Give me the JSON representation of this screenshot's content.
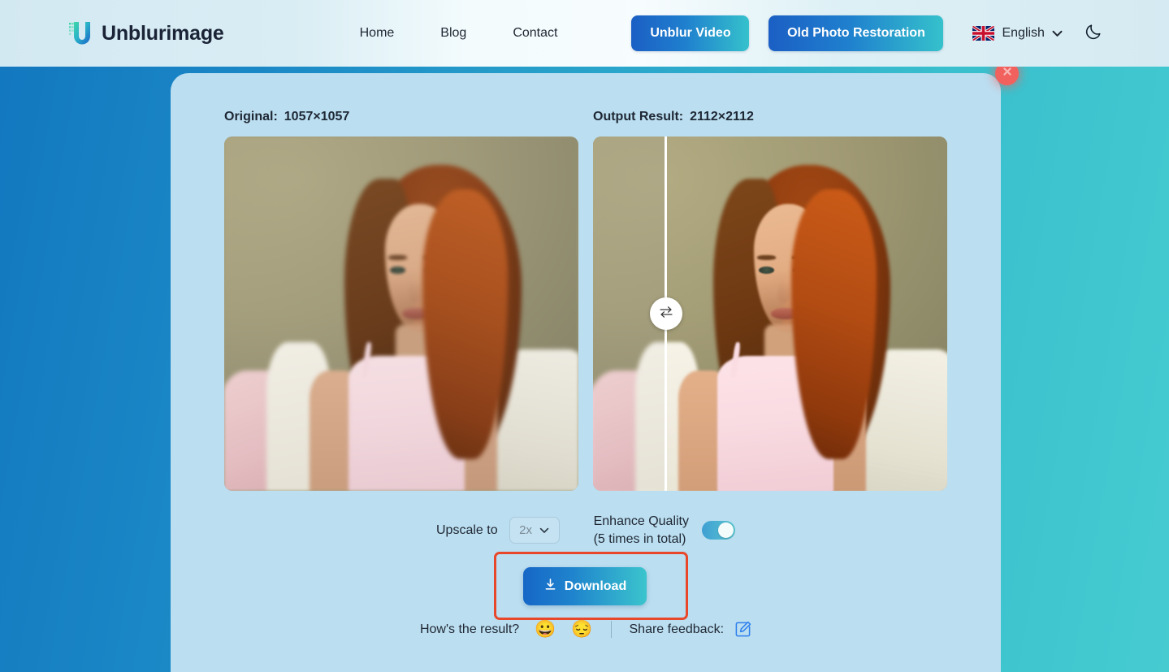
{
  "header": {
    "brand_name": "Unblurimage",
    "logo_icon": "unblurimage-u-logo",
    "nav": [
      {
        "label": "Home",
        "name": "nav-link-home"
      },
      {
        "label": "Blog",
        "name": "nav-link-blog"
      },
      {
        "label": "Contact",
        "name": "nav-link-contact"
      }
    ],
    "cta_unblur_video": "Unblur Video",
    "cta_old_photo": "Old Photo Restoration",
    "language": "English",
    "language_flag_icon": "uk-flag-icon",
    "language_chevron_icon": "chevron-down-icon",
    "dark_mode_icon": "moon-icon"
  },
  "panel": {
    "close_icon": "close-x-icon",
    "original_label": "Original:",
    "original_dimensions": "1057×1057",
    "output_label": "Output Result:",
    "output_dimensions": "2112×2112",
    "compare_handle_icon": "swap-left-right-arrows-icon"
  },
  "controls": {
    "upscale_label": "Upscale to",
    "upscale_value": "2x",
    "upscale_chevron_icon": "chevron-down-icon",
    "enhance_line1": "Enhance Quality",
    "enhance_line2": "(5 times in total)",
    "enhance_toggle_state": "on"
  },
  "download": {
    "label": "Download",
    "icon": "download-arrow-icon",
    "highlight_color": "#e8472a"
  },
  "feedback": {
    "question": "How's the result?",
    "happy_emoji": "😀",
    "sad_emoji": "😔",
    "share_label": "Share feedback:",
    "edit_icon": "pencil-edit-icon"
  },
  "colors": {
    "page_gradient_start": "#1277bf",
    "page_gradient_end": "#45cbd0",
    "panel_bg": "#bbdef0",
    "header_bg": "#d8ecf4",
    "accent_blue": "#1667c7",
    "accent_teal": "#3bc4cd",
    "close_red": "#f1615e",
    "highlight_red": "#e8472a",
    "text_dark": "#1f2733"
  }
}
